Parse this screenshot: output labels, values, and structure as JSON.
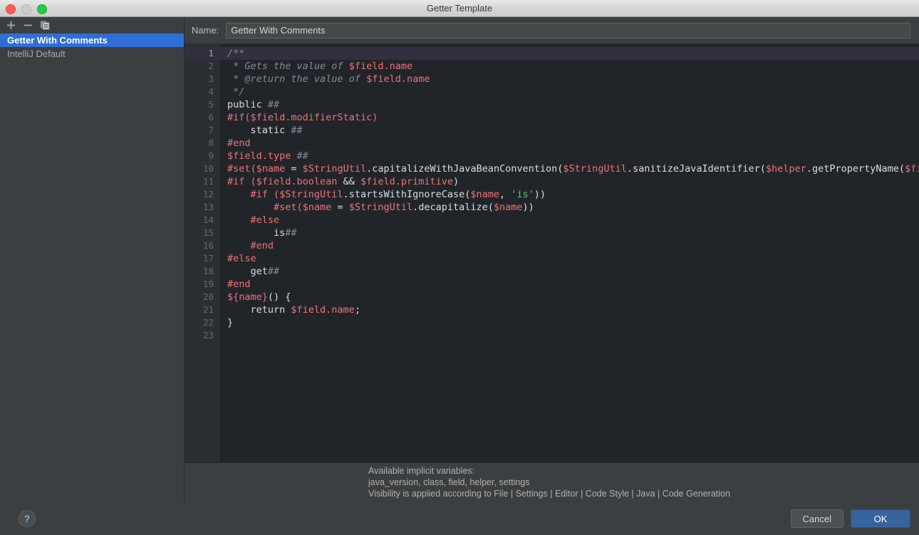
{
  "window": {
    "title": "Getter Template",
    "traffic_lights": [
      "close-button",
      "minimize-button",
      "maximize-button"
    ]
  },
  "sidebar": {
    "toolbar": [
      {
        "name": "add-button",
        "icon": "plus-icon",
        "label": "+"
      },
      {
        "name": "remove-button",
        "icon": "minus-icon",
        "label": "−"
      },
      {
        "name": "copy-button",
        "icon": "copy-icon",
        "label": ""
      }
    ],
    "items": [
      {
        "label": "Getter With Comments",
        "selected": true
      },
      {
        "label": "IntelliJ Default",
        "selected": false
      }
    ]
  },
  "name_field": {
    "label": "Name:",
    "value": "Getter With Comments",
    "placeholder": ""
  },
  "editor": {
    "line_numbers": [
      "1",
      "2",
      "3",
      "4",
      "5",
      "6",
      "7",
      "8",
      "9",
      "10",
      "11",
      "12",
      "13",
      "14",
      "15",
      "16",
      "17",
      "18",
      "19",
      "20",
      "21",
      "22",
      "23"
    ],
    "current_line": 1,
    "lines": [
      {
        "n": 1,
        "tokens": [
          {
            "t": "comment",
            "s": "/**"
          }
        ]
      },
      {
        "n": 2,
        "tokens": [
          {
            "t": "comment",
            "s": " * Gets the value of "
          },
          {
            "t": "var",
            "s": "$field.name"
          }
        ]
      },
      {
        "n": 3,
        "tokens": [
          {
            "t": "comment",
            "s": " * @return the value of "
          },
          {
            "t": "var",
            "s": "$field.name"
          }
        ]
      },
      {
        "n": 4,
        "tokens": [
          {
            "t": "comment",
            "s": " */"
          }
        ]
      },
      {
        "n": 5,
        "tokens": [
          {
            "t": "plain",
            "s": "public "
          },
          {
            "t": "comment",
            "s": "##"
          }
        ]
      },
      {
        "n": 6,
        "tokens": [
          {
            "t": "direct",
            "s": "#if("
          },
          {
            "t": "var",
            "s": "$field.modifierStatic"
          },
          {
            "t": "direct",
            "s": ")"
          }
        ]
      },
      {
        "n": 7,
        "tokens": [
          {
            "t": "plain",
            "s": "    static "
          },
          {
            "t": "comment",
            "s": "##"
          }
        ]
      },
      {
        "n": 8,
        "tokens": [
          {
            "t": "direct",
            "s": "#end"
          }
        ]
      },
      {
        "n": 9,
        "tokens": [
          {
            "t": "var",
            "s": "$field.type"
          },
          {
            "t": "plain",
            "s": " "
          },
          {
            "t": "comment",
            "s": "##"
          }
        ]
      },
      {
        "n": 10,
        "tokens": [
          {
            "t": "direct",
            "s": "#set("
          },
          {
            "t": "var",
            "s": "$name"
          },
          {
            "t": "plain",
            "s": " = "
          },
          {
            "t": "var",
            "s": "$StringUtil"
          },
          {
            "t": "plain",
            "s": ".capitalizeWithJavaBeanConvention("
          },
          {
            "t": "var",
            "s": "$StringUtil"
          },
          {
            "t": "plain",
            "s": ".sanitizeJavaIdentifier("
          },
          {
            "t": "var",
            "s": "$helper"
          },
          {
            "t": "plain",
            "s": ".getPropertyName("
          },
          {
            "t": "var",
            "s": "$fiel"
          }
        ]
      },
      {
        "n": 11,
        "tokens": [
          {
            "t": "direct",
            "s": "#if ("
          },
          {
            "t": "var",
            "s": "$field.boolean"
          },
          {
            "t": "plain",
            "s": " && "
          },
          {
            "t": "var",
            "s": "$field.primitive"
          },
          {
            "t": "plain",
            "s": ")"
          }
        ]
      },
      {
        "n": 12,
        "tokens": [
          {
            "t": "plain",
            "s": "    "
          },
          {
            "t": "direct",
            "s": "#if ("
          },
          {
            "t": "var",
            "s": "$StringUtil"
          },
          {
            "t": "plain",
            "s": ".startsWithIgnoreCase("
          },
          {
            "t": "var",
            "s": "$name"
          },
          {
            "t": "plain",
            "s": ", "
          },
          {
            "t": "string",
            "s": "'is'"
          },
          {
            "t": "plain",
            "s": "))"
          }
        ]
      },
      {
        "n": 13,
        "tokens": [
          {
            "t": "plain",
            "s": "        "
          },
          {
            "t": "direct",
            "s": "#set("
          },
          {
            "t": "var",
            "s": "$name"
          },
          {
            "t": "plain",
            "s": " = "
          },
          {
            "t": "var",
            "s": "$StringUtil"
          },
          {
            "t": "plain",
            "s": ".decapitalize("
          },
          {
            "t": "var",
            "s": "$name"
          },
          {
            "t": "plain",
            "s": "))"
          }
        ]
      },
      {
        "n": 14,
        "tokens": [
          {
            "t": "plain",
            "s": "    "
          },
          {
            "t": "direct",
            "s": "#else"
          }
        ]
      },
      {
        "n": 15,
        "tokens": [
          {
            "t": "plain",
            "s": "        is"
          },
          {
            "t": "comment",
            "s": "##"
          }
        ]
      },
      {
        "n": 16,
        "tokens": [
          {
            "t": "plain",
            "s": "    "
          },
          {
            "t": "direct",
            "s": "#end"
          }
        ]
      },
      {
        "n": 17,
        "tokens": [
          {
            "t": "direct",
            "s": "#else"
          }
        ]
      },
      {
        "n": 18,
        "tokens": [
          {
            "t": "plain",
            "s": "    get"
          },
          {
            "t": "comment",
            "s": "##"
          }
        ]
      },
      {
        "n": 19,
        "tokens": [
          {
            "t": "direct",
            "s": "#end"
          }
        ]
      },
      {
        "n": 20,
        "tokens": [
          {
            "t": "var",
            "s": "${name}"
          },
          {
            "t": "plain",
            "s": "() {"
          }
        ]
      },
      {
        "n": 21,
        "tokens": [
          {
            "t": "plain",
            "s": "    return "
          },
          {
            "t": "var",
            "s": "$field.name"
          },
          {
            "t": "plain",
            "s": ";"
          }
        ]
      },
      {
        "n": 22,
        "tokens": [
          {
            "t": "plain",
            "s": "}"
          }
        ]
      },
      {
        "n": 23,
        "tokens": []
      }
    ]
  },
  "help": {
    "lines": [
      "Available implicit variables:",
      "java_version, class, field, helper, settings",
      "Visibility is applied according to File | Settings | Editor | Code Style | Java | Code Generation"
    ]
  },
  "footer": {
    "help_icon": "question-mark-icon",
    "help_glyph": "?",
    "cancel_label": "Cancel",
    "ok_label": "OK"
  },
  "colors": {
    "accent_selection": "#2f6fd5",
    "ok_button": "#37639e",
    "editor_bg": "#212529",
    "panel_bg": "#3c3f41",
    "gutter_bg": "#2b2f33",
    "current_line": "#32303f",
    "token_comment": "#7f8b99",
    "token_directive": "#f07178",
    "token_variable": "#f07178",
    "token_string": "#6ec07c",
    "token_plain": "#d8dee4"
  }
}
